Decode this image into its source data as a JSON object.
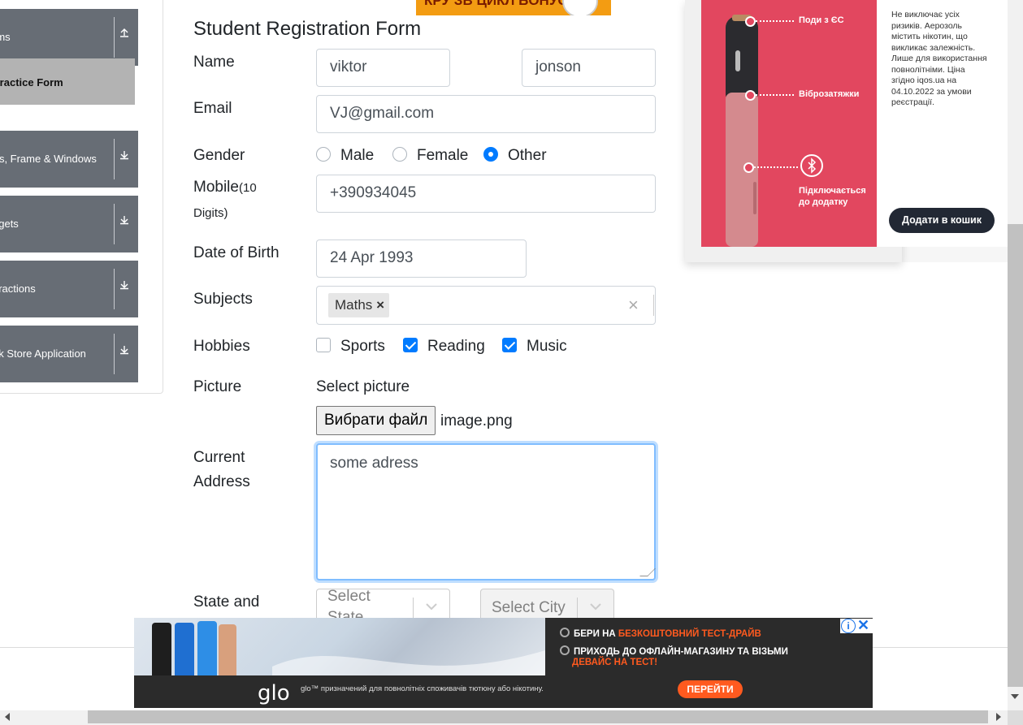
{
  "sidebar": {
    "groups": [
      {
        "label": "rms",
        "icon": "upload-icon"
      },
      {
        "label": "rts, Frame & Windows",
        "icon": "download-icon"
      },
      {
        "label": "dgets",
        "icon": "download-icon"
      },
      {
        "label": "eractions",
        "icon": "download-icon"
      },
      {
        "label": "ok Store Application",
        "icon": "download-icon"
      }
    ],
    "active_item": "Practice Form"
  },
  "top_ad": {
    "title": "КРУ ЗВ ЦИКЛ БОНУС",
    "accent": "#f39c12"
  },
  "form": {
    "title": "Student Registration Form",
    "name": {
      "label": "Name",
      "first": "viktor",
      "last": "jonson"
    },
    "email": {
      "label": "Email",
      "value": "VJ@gmail.com"
    },
    "gender": {
      "label": "Gender",
      "options": [
        "Male",
        "Female",
        "Other"
      ],
      "selected": "Other"
    },
    "mobile": {
      "label": "Mobile",
      "hint": "(10",
      "hint2": "Digits)",
      "value": "+390934045"
    },
    "dob": {
      "label": "Date of Birth",
      "value": "24 Apr 1993"
    },
    "subjects": {
      "label": "Subjects",
      "chips": [
        "Maths"
      ],
      "clear": "×",
      "chip_remove": "×"
    },
    "hobbies": {
      "label": "Hobbies",
      "options": [
        {
          "label": "Sports",
          "checked": false
        },
        {
          "label": "Reading",
          "checked": true
        },
        {
          "label": "Music",
          "checked": true
        }
      ]
    },
    "picture": {
      "label": "Picture",
      "caption": "Select picture",
      "button": "Вибрати файл",
      "file": "image.png"
    },
    "address": {
      "label1": "Current",
      "label2": "Address",
      "value": "some adress"
    },
    "state_city": {
      "label": "State and",
      "state_placeholder": "Select",
      "state_placeholder2": "State",
      "city_placeholder": "Select City"
    },
    "accent": "#007bff"
  },
  "right_ad": {
    "label1": "Поди з ЄС",
    "label2": "Віброзатяжки",
    "label3a": "Підключається",
    "label3b": "до додатку",
    "disclaimer": "Не виключає усіх ризиків. Аерозоль містить нікотин, що викликає залежність. Лише для використання повнолітніми. Ціна згідно iqos.ua на 04.10.2022 за умови реєстрації.",
    "button": "Додати в кошик",
    "accent": "#e2475f"
  },
  "bottom_ad": {
    "line1a": "БЕРИ НА ",
    "line1b": "БЕЗКОШТОВНИЙ ТЕСТ-ДРАЙВ",
    "line2a": "ПРИХОДЬ ДО ОФЛАЙН-МАГАЗИНУ ТА ВІЗЬМИ",
    "line2b": "ДЕВАЙС НА ТЕСТ!",
    "logo": "glo",
    "small": "glo™ призначений для повнолітніх споживачів тютюну або нікотину.",
    "button": "ПЕРЕЙТИ",
    "info": "i",
    "close": "✕",
    "accent": "#ff5a1f"
  }
}
